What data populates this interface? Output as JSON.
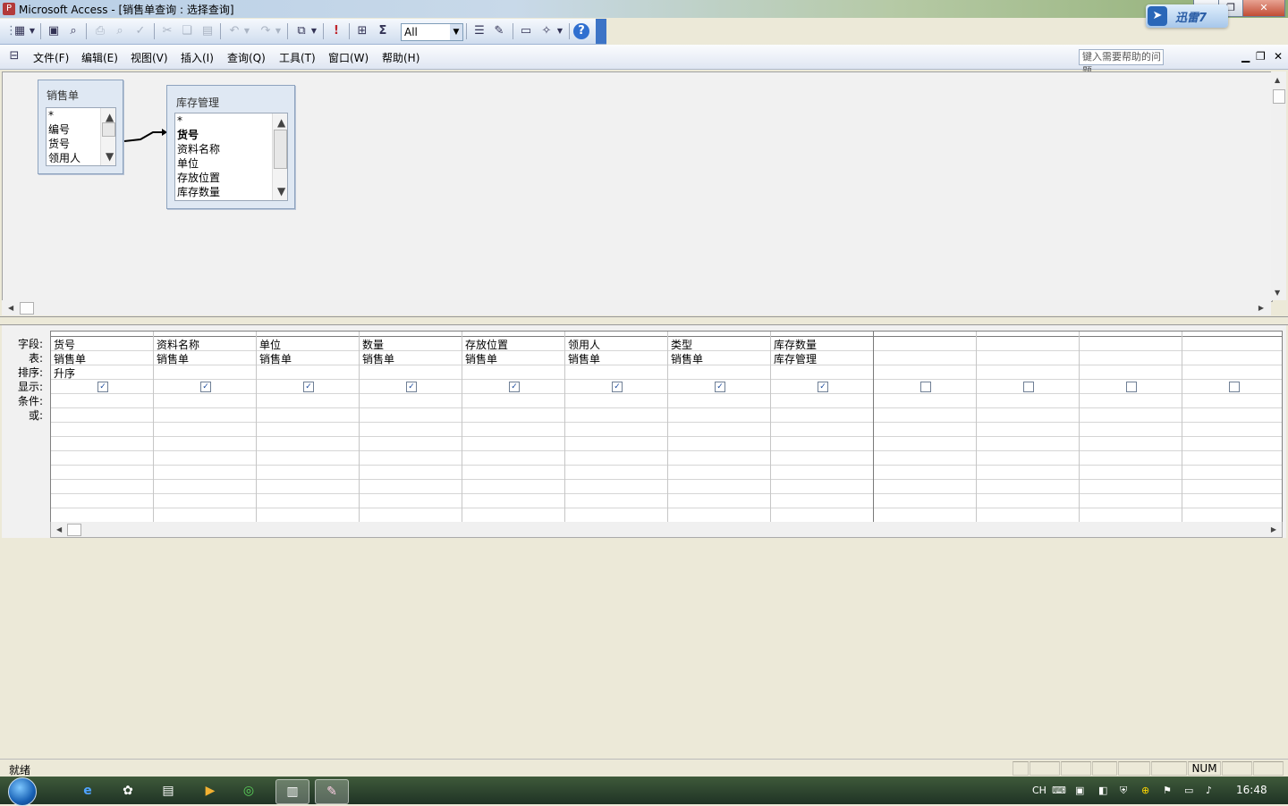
{
  "window": {
    "app_icon_glyph": "P",
    "title": "Microsoft Access - [销售单查询 : 选择查询]"
  },
  "window_buttons": {
    "minimize": "▁",
    "restore": "❐",
    "close": "✕"
  },
  "toolbar": {
    "combo_value": "All",
    "combo_arrow": "▼",
    "sigma": "Σ",
    "exclaim": "!",
    "help_glyph": "?"
  },
  "menu": {
    "items": [
      "文件(F)",
      "编辑(E)",
      "视图(V)",
      "插入(I)",
      "查询(Q)",
      "工具(T)",
      "窗口(W)",
      "帮助(H)"
    ],
    "help_placeholder": "键入需要帮助的问题",
    "mdi_minimize": "▁",
    "mdi_restore": "❐",
    "mdi_close": "✕"
  },
  "xunlei": {
    "label": "迅雷7"
  },
  "tables": {
    "sales": {
      "caption": "销售单",
      "fields": [
        "*",
        "编号",
        "货号",
        "领用人"
      ]
    },
    "inventory": {
      "caption": "库存管理",
      "fields": [
        "*",
        "货号",
        "资料名称",
        "单位",
        "存放位置",
        "库存数量"
      ]
    }
  },
  "row_labels": {
    "field": "字段:",
    "table": "表:",
    "sort": "排序:",
    "show": "显示:",
    "criteria": "条件:",
    "or": "或:"
  },
  "grid": {
    "columns": [
      {
        "field": "货号",
        "table": "销售单",
        "sort": "升序",
        "show": true
      },
      {
        "field": "资料名称",
        "table": "销售单",
        "sort": "",
        "show": true
      },
      {
        "field": "单位",
        "table": "销售单",
        "sort": "",
        "show": true
      },
      {
        "field": "数量",
        "table": "销售单",
        "sort": "",
        "show": true
      },
      {
        "field": "存放位置",
        "table": "销售单",
        "sort": "",
        "show": true
      },
      {
        "field": "领用人",
        "table": "销售单",
        "sort": "",
        "show": true
      },
      {
        "field": "类型",
        "table": "销售单",
        "sort": "",
        "show": true
      },
      {
        "field": "库存数量",
        "table": "库存管理",
        "sort": "",
        "show": true
      },
      {
        "field": "",
        "table": "",
        "sort": "",
        "show": false
      },
      {
        "field": "",
        "table": "",
        "sort": "",
        "show": false
      },
      {
        "field": "",
        "table": "",
        "sort": "",
        "show": false
      },
      {
        "field": "",
        "table": "",
        "sort": "",
        "show": false
      }
    ]
  },
  "status": {
    "text": "就绪",
    "num": "NUM"
  },
  "taskbar": {
    "lang": "CH",
    "clock": "16:48"
  },
  "colors": {
    "accent": "#3d74c6",
    "title_gradient_end": "#8fae73"
  }
}
